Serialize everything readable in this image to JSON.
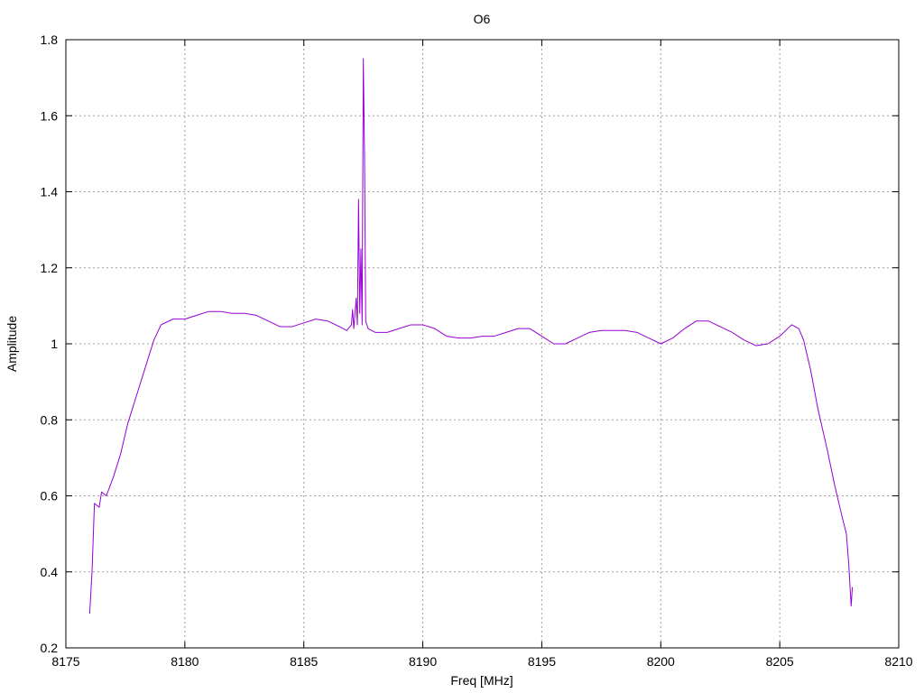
{
  "chart_data": {
    "type": "line",
    "title": "O6",
    "xlabel": "Freq [MHz]",
    "ylabel": "Amplitude",
    "xlim": [
      8175,
      8210
    ],
    "ylim": [
      0.2,
      1.8
    ],
    "xticks": [
      8175,
      8180,
      8185,
      8190,
      8195,
      8200,
      8205,
      8210
    ],
    "yticks": [
      0.2,
      0.4,
      0.6,
      0.8,
      1,
      1.2,
      1.4,
      1.6,
      1.8
    ],
    "ytick_labels": [
      "0.2",
      "0.4",
      "0.6",
      "0.8",
      "1",
      "1.2",
      "1.4",
      "1.6",
      "1.8"
    ],
    "grid": true,
    "legend": "none",
    "series": [
      {
        "color": "#9400d3",
        "points": [
          [
            8176.0,
            0.29
          ],
          [
            8176.1,
            0.4
          ],
          [
            8176.2,
            0.58
          ],
          [
            8176.4,
            0.57
          ],
          [
            8176.5,
            0.61
          ],
          [
            8176.7,
            0.6
          ],
          [
            8177.0,
            0.65
          ],
          [
            8177.3,
            0.71
          ],
          [
            8177.6,
            0.79
          ],
          [
            8178.0,
            0.87
          ],
          [
            8178.4,
            0.95
          ],
          [
            8178.7,
            1.01
          ],
          [
            8179.0,
            1.05
          ],
          [
            8179.5,
            1.065
          ],
          [
            8180.0,
            1.065
          ],
          [
            8180.5,
            1.075
          ],
          [
            8181.0,
            1.085
          ],
          [
            8181.5,
            1.085
          ],
          [
            8182.0,
            1.08
          ],
          [
            8182.5,
            1.08
          ],
          [
            8183.0,
            1.075
          ],
          [
            8183.5,
            1.06
          ],
          [
            8184.0,
            1.045
          ],
          [
            8184.5,
            1.045
          ],
          [
            8185.0,
            1.055
          ],
          [
            8185.5,
            1.065
          ],
          [
            8186.0,
            1.06
          ],
          [
            8186.5,
            1.045
          ],
          [
            8186.8,
            1.035
          ],
          [
            8187.0,
            1.05
          ],
          [
            8187.05,
            1.09
          ],
          [
            8187.1,
            1.04
          ],
          [
            8187.2,
            1.12
          ],
          [
            8187.25,
            1.05
          ],
          [
            8187.3,
            1.38
          ],
          [
            8187.35,
            1.08
          ],
          [
            8187.4,
            1.25
          ],
          [
            8187.45,
            1.05
          ],
          [
            8187.5,
            1.75
          ],
          [
            8187.55,
            1.5
          ],
          [
            8187.6,
            1.06
          ],
          [
            8187.7,
            1.04
          ],
          [
            8188.0,
            1.03
          ],
          [
            8188.5,
            1.03
          ],
          [
            8189.0,
            1.04
          ],
          [
            8189.5,
            1.05
          ],
          [
            8190.0,
            1.05
          ],
          [
            8190.5,
            1.04
          ],
          [
            8191.0,
            1.02
          ],
          [
            8191.5,
            1.015
          ],
          [
            8192.0,
            1.015
          ],
          [
            8192.5,
            1.02
          ],
          [
            8193.0,
            1.02
          ],
          [
            8193.5,
            1.03
          ],
          [
            8194.0,
            1.04
          ],
          [
            8194.5,
            1.04
          ],
          [
            8195.0,
            1.02
          ],
          [
            8195.5,
            1.0
          ],
          [
            8196.0,
            1.0
          ],
          [
            8196.5,
            1.015
          ],
          [
            8197.0,
            1.03
          ],
          [
            8197.5,
            1.035
          ],
          [
            8198.0,
            1.035
          ],
          [
            8198.5,
            1.035
          ],
          [
            8199.0,
            1.03
          ],
          [
            8199.5,
            1.015
          ],
          [
            8200.0,
            1.0
          ],
          [
            8200.5,
            1.015
          ],
          [
            8201.0,
            1.04
          ],
          [
            8201.5,
            1.06
          ],
          [
            8202.0,
            1.06
          ],
          [
            8202.5,
            1.045
          ],
          [
            8203.0,
            1.03
          ],
          [
            8203.5,
            1.01
          ],
          [
            8204.0,
            0.995
          ],
          [
            8204.5,
            1.0
          ],
          [
            8205.0,
            1.02
          ],
          [
            8205.5,
            1.05
          ],
          [
            8205.8,
            1.04
          ],
          [
            8206.0,
            1.01
          ],
          [
            8206.3,
            0.93
          ],
          [
            8206.6,
            0.83
          ],
          [
            8207.0,
            0.72
          ],
          [
            8207.3,
            0.63
          ],
          [
            8207.6,
            0.55
          ],
          [
            8207.8,
            0.5
          ],
          [
            8207.9,
            0.42
          ],
          [
            8208.0,
            0.31
          ],
          [
            8208.05,
            0.36
          ]
        ]
      }
    ]
  }
}
